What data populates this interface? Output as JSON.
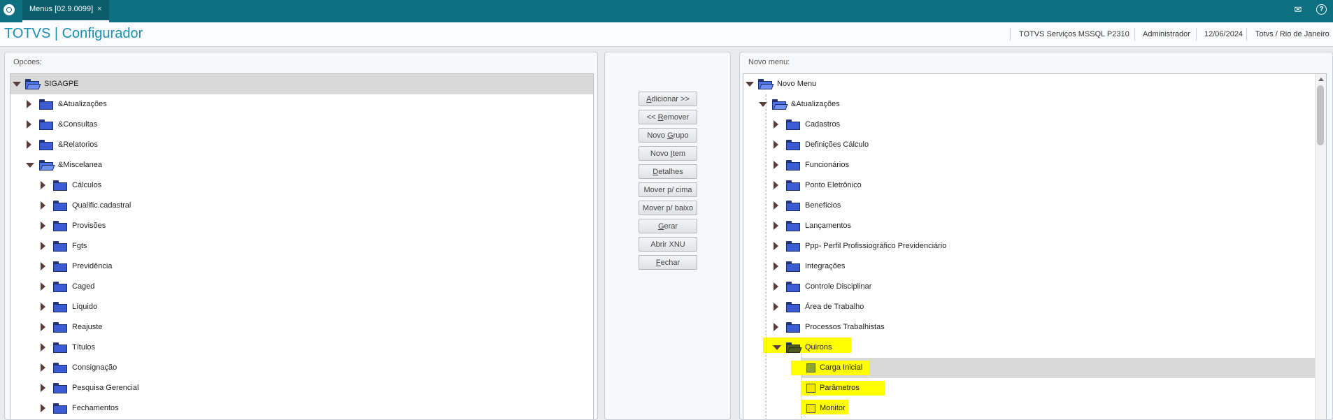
{
  "topbar": {
    "tab_label": "Menus [02.9.0099]",
    "tab_close": "×",
    "mail_icon": "mail-icon",
    "help_icon": "?"
  },
  "header": {
    "title": "TOTVS | Configurador",
    "environment": "TOTVS Serviços MSSQL P2310",
    "user": "Administrador",
    "date": "12/06/2024",
    "branch": "Totvs / Rio de Janeiro"
  },
  "left_panel": {
    "label": "Opcoes:",
    "root": "SIGAGPE",
    "level1": [
      "&Atualizações",
      "&Consultas",
      "&Relatorios",
      "&Miscelanea"
    ],
    "level2": [
      "Cálculos",
      "Qualific.cadastral",
      "Provisões",
      "Fgts",
      "Previdência",
      "Caged",
      "Líquido",
      "Reajuste",
      "Títulos",
      "Consignação",
      "Pesquisa Gerencial",
      "Fechamentos"
    ]
  },
  "middle_panel": {
    "buttons": [
      {
        "pre": "",
        "u": "A",
        "post": "dicionar >>"
      },
      {
        "pre": "<< ",
        "u": "R",
        "post": "emover"
      },
      {
        "pre": "Novo ",
        "u": "G",
        "post": "rupo"
      },
      {
        "pre": "Novo ",
        "u": "I",
        "post": "tem"
      },
      {
        "pre": "",
        "u": "D",
        "post": "etalhes"
      },
      {
        "pre": "Mover p/ cima",
        "u": "",
        "post": ""
      },
      {
        "pre": "Mover p/ baixo",
        "u": "",
        "post": ""
      },
      {
        "pre": "",
        "u": "G",
        "post": "erar"
      },
      {
        "pre": "Abrir XNU",
        "u": "",
        "post": ""
      },
      {
        "pre": "",
        "u": "F",
        "post": "echar"
      }
    ]
  },
  "right_panel": {
    "label": "Novo menu:",
    "root": "Novo Menu",
    "level1": "&Atualizações",
    "level2": [
      "Cadastros",
      "Definições Cálculo",
      "Funcionários",
      "Ponto Eletrônico",
      "Benefícios",
      "Lançamentos",
      "Ppp- Perfil Profissiográfico Previdenciário",
      "Integrações",
      "Controle Disciplinar",
      "Área de Trabalho",
      "Processos Trabalhistas",
      "Quirons"
    ],
    "items": [
      "Carga Inicial",
      "Parâmetros",
      "Monitor"
    ],
    "highlight_color": "#ffff00",
    "selected_item": "Carga Inicial"
  }
}
